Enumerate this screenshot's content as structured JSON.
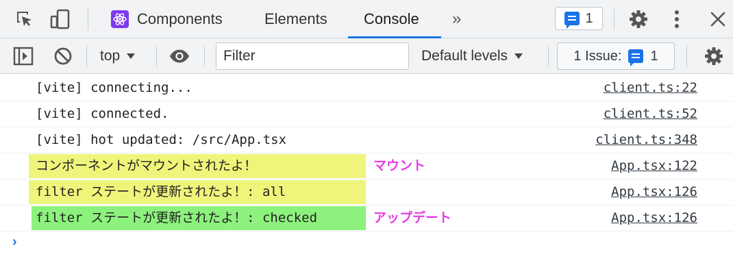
{
  "tabs": {
    "components": "Components",
    "elements": "Elements",
    "console": "Console",
    "more": "»",
    "message_count": "1"
  },
  "toolbar": {
    "context": "top",
    "filter_placeholder": "Filter",
    "levels": "Default levels",
    "issues_label": "1 Issue:",
    "issues_count": "1"
  },
  "messages": [
    {
      "text": "[vite] connecting...",
      "source": "client.ts:22"
    },
    {
      "text": "[vite] connected.",
      "source": "client.ts:52"
    },
    {
      "text": "[vite] hot updated: /src/App.tsx",
      "source": "client.ts:348"
    },
    {
      "text": "コンポーネントがマウントされたよ！",
      "source": "App.tsx:122",
      "note": "マウント"
    },
    {
      "text": "filter ステートが更新されたよ！: all",
      "source": "App.tsx:126"
    },
    {
      "text": "filter ステートが更新されたよ！: checked",
      "source": "App.tsx:126",
      "note": "アップデート"
    }
  ],
  "prompt": "›",
  "colors": {
    "accent": "#1a73e8",
    "highlight_yellow": "#eff57a",
    "highlight_green": "#8df27d",
    "annotation": "#e83ae8"
  },
  "icons": [
    "inspect-element-icon",
    "device-toolbar-icon",
    "react-icon",
    "message-icon",
    "gear-icon",
    "kebab-menu-icon",
    "close-icon",
    "sidebar-toggle-icon",
    "clear-console-icon",
    "eye-icon"
  ]
}
